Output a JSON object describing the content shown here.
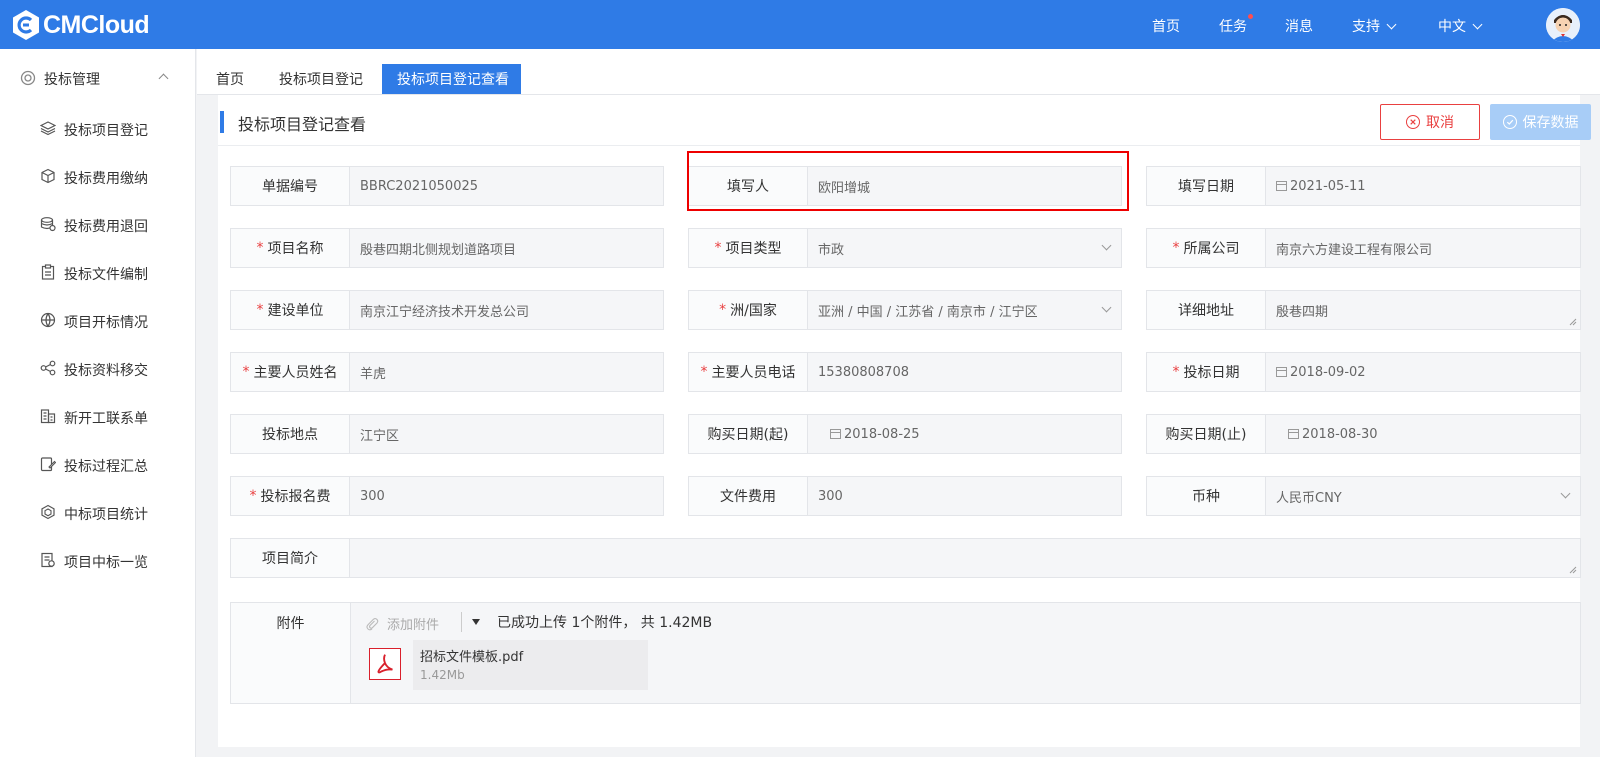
{
  "app": {
    "logo_text": "CMCloud"
  },
  "topnav": {
    "home": "首页",
    "tasks": "任务",
    "messages": "消息",
    "support": "支持",
    "language": "中文"
  },
  "sidebar": {
    "group": "投标管理",
    "items": [
      {
        "label": "投标项目登记",
        "icon": "layers-icon"
      },
      {
        "label": "投标费用缴纳",
        "icon": "cube-icon"
      },
      {
        "label": "投标费用退回",
        "icon": "coins-icon"
      },
      {
        "label": "投标文件编制",
        "icon": "clipboard-icon"
      },
      {
        "label": "项目开标情况",
        "icon": "globe-icon"
      },
      {
        "label": "投标资料移交",
        "icon": "share-icon"
      },
      {
        "label": "新开工联系单",
        "icon": "building-icon"
      },
      {
        "label": "投标过程汇总",
        "icon": "edit-doc-icon"
      },
      {
        "label": "中标项目统计",
        "icon": "hex-icon"
      },
      {
        "label": "项目中标一览",
        "icon": "list-doc-icon"
      }
    ]
  },
  "tabs": [
    "首页",
    "投标项目登记",
    "投标项目登记查看"
  ],
  "panel": {
    "title": "投标项目登记查看",
    "cancel_label": "取消",
    "save_label": "保存数据"
  },
  "form": {
    "doc_no": {
      "label": "单据编号",
      "value": "BBRC2021050025"
    },
    "filler": {
      "label": "填写人",
      "value": "欧阳增城"
    },
    "fill_date": {
      "label": "填写日期",
      "value": "2021-05-11"
    },
    "project_name": {
      "label": "项目名称",
      "value": "殷巷四期北侧规划道路项目"
    },
    "project_type": {
      "label": "项目类型",
      "value": "市政"
    },
    "company": {
      "label": "所属公司",
      "value": "南京六方建设工程有限公司"
    },
    "builder": {
      "label": "建设单位",
      "value": "南京江宁经济技术开发总公司"
    },
    "region": {
      "label": "洲/国家",
      "value": "亚洲 / 中国 / 江苏省 / 南京市 / 江宁区"
    },
    "address": {
      "label": "详细地址",
      "value": "殷巷四期"
    },
    "person_name": {
      "label": "主要人员姓名",
      "value": "羊虎"
    },
    "person_phone": {
      "label": "主要人员电话",
      "value": "15380808708"
    },
    "bid_date": {
      "label": "投标日期",
      "value": "2018-09-02"
    },
    "bid_place": {
      "label": "投标地点",
      "value": "江宁区"
    },
    "buy_start": {
      "label": "购买日期(起)",
      "value": "2018-08-25"
    },
    "buy_end": {
      "label": "购买日期(止)",
      "value": "2018-08-30"
    },
    "signup_fee": {
      "label": "投标报名费",
      "value": "300"
    },
    "doc_fee": {
      "label": "文件费用",
      "value": "300"
    },
    "currency": {
      "label": "币种",
      "value": "人民币CNY"
    },
    "summary": {
      "label": "项目简介",
      "value": ""
    },
    "attachment": {
      "label": "附件",
      "add_label": "添加附件",
      "status": "已成功上传 1个附件， 共 1.42MB",
      "file_name": "招标文件模板.pdf",
      "file_size": "1.42Mb"
    }
  },
  "colors": {
    "primary": "#2f7be6",
    "danger": "#e94040",
    "required": "#e94040",
    "highlight": "#ee0000"
  }
}
